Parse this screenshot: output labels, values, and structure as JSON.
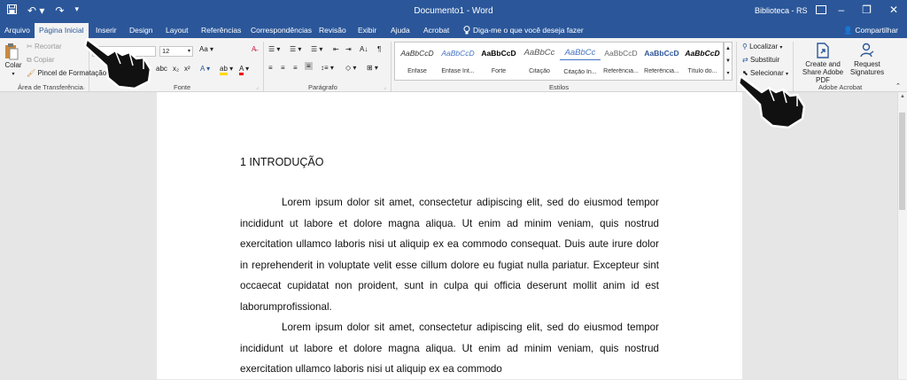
{
  "titlebar": {
    "title": "Documento1 - Word",
    "account": "Biblioteca - RS"
  },
  "tabs": [
    {
      "label": "Arquivo"
    },
    {
      "label": "Página Inicial"
    },
    {
      "label": "Inserir"
    },
    {
      "label": "Design"
    },
    {
      "label": "Layout"
    },
    {
      "label": "Referências"
    },
    {
      "label": "Correspondências"
    },
    {
      "label": "Revisão"
    },
    {
      "label": "Exibir"
    },
    {
      "label": "Ajuda"
    },
    {
      "label": "Acrobat"
    }
  ],
  "tell_me": "Diga-me o que você deseja fazer",
  "share": "Compartilhar",
  "clipboard": {
    "paste": "Colar",
    "cut": "Recortar",
    "copy": "Copiar",
    "format_painter": "Pincel de Formatação",
    "group_label": "Área de Transferência"
  },
  "font": {
    "size": "12",
    "group_label": "Fonte"
  },
  "paragraph": {
    "group_label": "Parágrafo"
  },
  "styles": {
    "group_label": "Estilos",
    "items": [
      {
        "sample": "AaBbCcD",
        "name": "Ênfase",
        "color": "#333333"
      },
      {
        "sample": "AaBbCcD",
        "name": "Ênfase Int...",
        "color": "#4472c4"
      },
      {
        "sample": "AaBbCcD",
        "name": "Forte",
        "color": "#000000"
      },
      {
        "sample": "AaBbCc",
        "name": "Citação",
        "color": "#555555"
      },
      {
        "sample": "AaBbCc",
        "name": "Citação In...",
        "color": "#4472c4"
      },
      {
        "sample": "AaBbCcD",
        "name": "Referência...",
        "color": "#666666"
      },
      {
        "sample": "AaBbCcD",
        "name": "Referência...",
        "color": "#2e5597"
      },
      {
        "sample": "AaBbCcD",
        "name": "Título do...",
        "color": "#000000"
      }
    ]
  },
  "editing": {
    "find": "Localizar",
    "replace": "Substituir",
    "select": "Selecionar"
  },
  "acrobat": {
    "create_share": "Create and Share Adobe PDF",
    "request_signatures": "Request Signatures",
    "group_label": "Adobe Acrobat"
  },
  "document": {
    "heading": "1 INTRODUÇÃO",
    "paragraph1": "Lorem ipsum dolor sit amet, consectetur adipiscing elit, sed do eiusmod tempor incididunt ut labore et dolore magna aliqua. Ut enim ad minim veniam, quis nostrud exercitation ullamco laboris nisi ut aliquip ex ea commodo consequat. Duis aute irure dolor in reprehenderit in voluptate velit esse cillum dolore eu fugiat nulla pariatur. Excepteur sint occaecat cupidatat non proident, sunt in culpa qui officia deserunt mollit anim id est laborumprofissional.",
    "paragraph2": "Lorem ipsum dolor sit amet, consectetur adipiscing elit, sed do eiusmod tempor incididunt ut labore et dolore magna aliqua. Ut enim ad minim veniam, quis nostrud exercitation ullamco laboris nisi ut aliquip ex ea commodo"
  },
  "colors": {
    "word_blue": "#2b579a",
    "ribbon": "#f3f3f3",
    "canvas": "#e6e6e6"
  }
}
